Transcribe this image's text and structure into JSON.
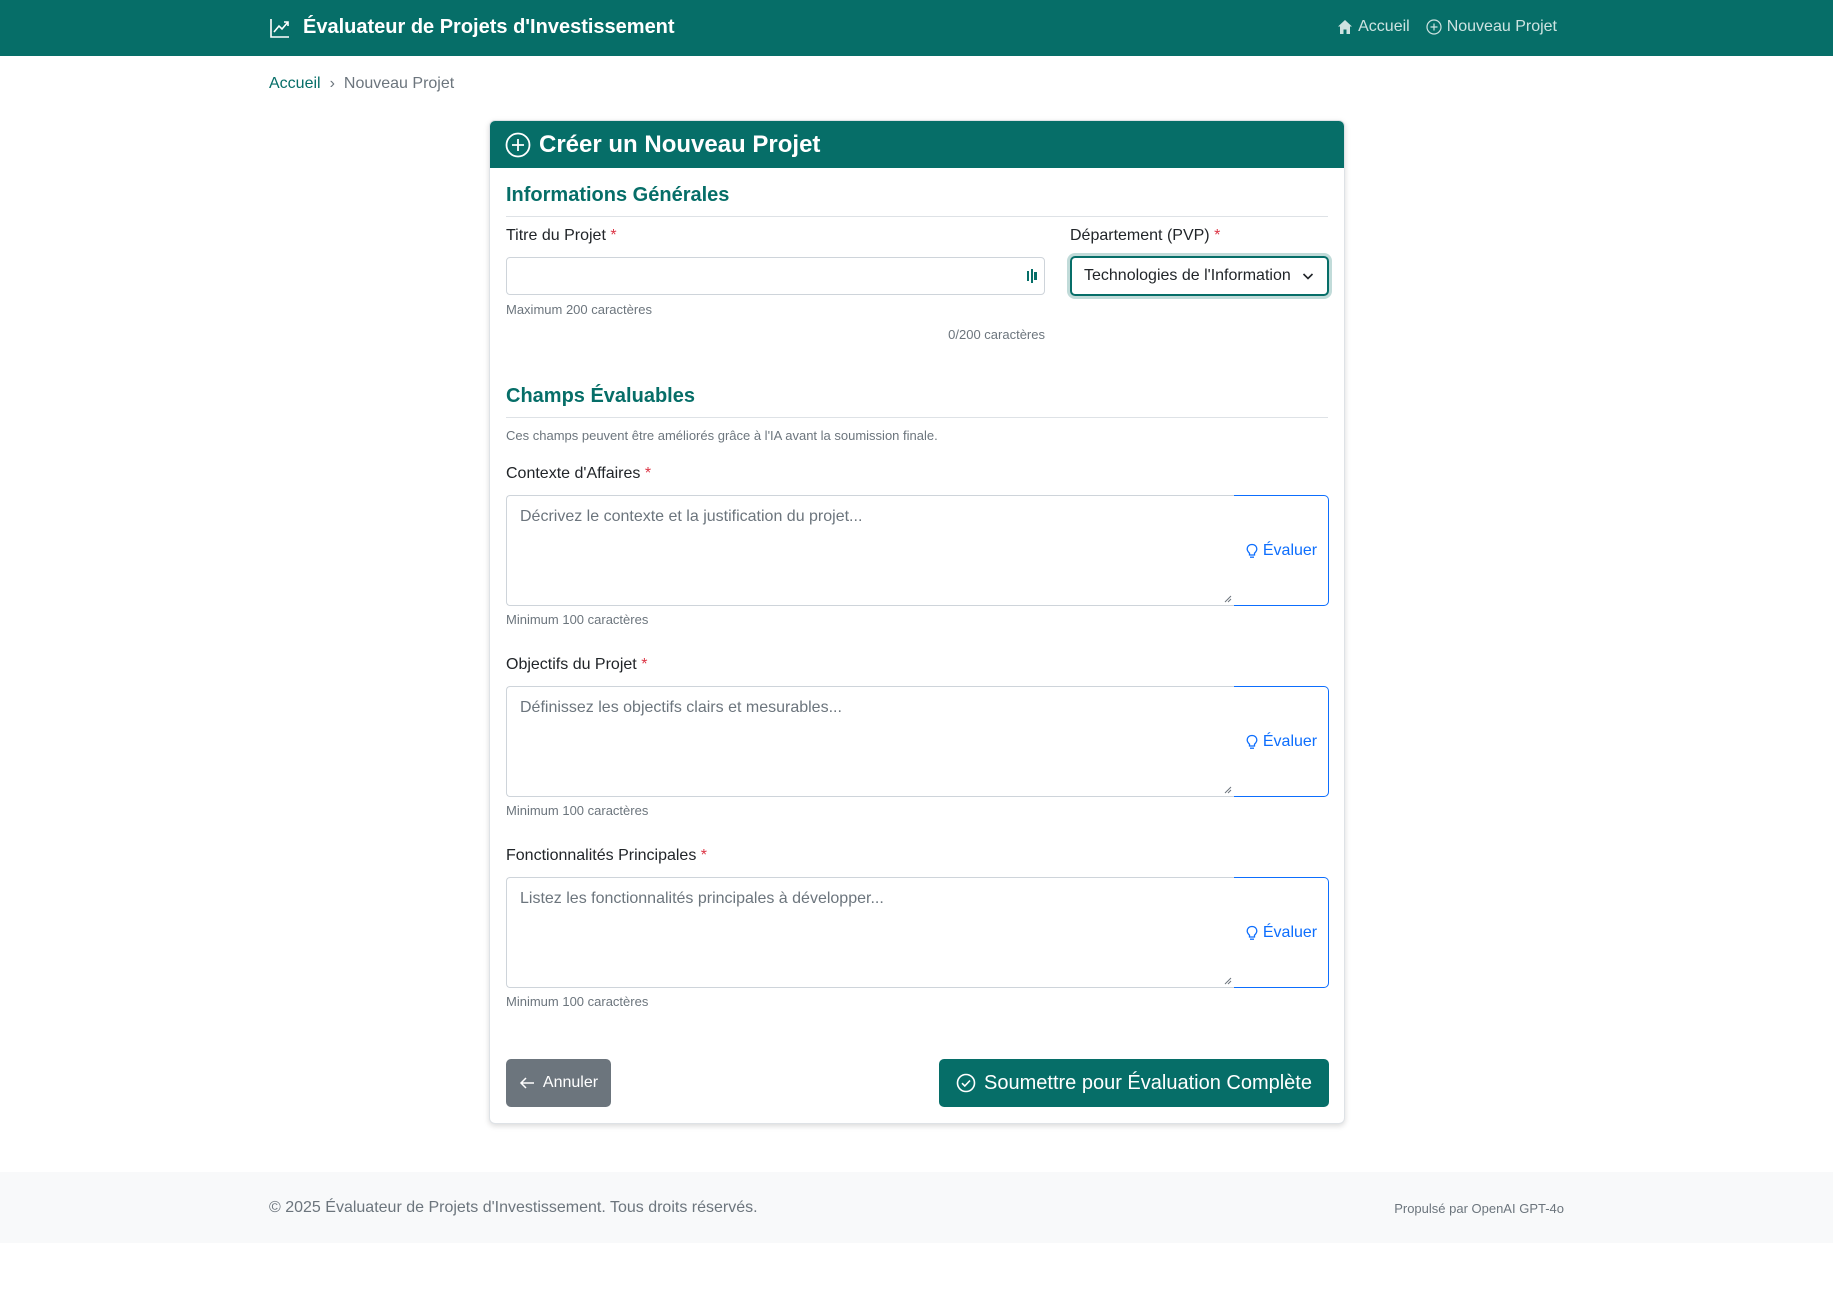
{
  "navbar": {
    "brand": "Évaluateur de Projets d'Investissement",
    "links": [
      {
        "label": "Accueil",
        "icon": "house-icon"
      },
      {
        "label": "Nouveau Projet",
        "icon": "plus-circle-icon"
      }
    ]
  },
  "breadcrumb": {
    "home": "Accueil",
    "separator": "›",
    "current": "Nouveau Projet"
  },
  "card": {
    "title": "Créer un Nouveau Projet"
  },
  "general": {
    "title": "Informations Générales",
    "project_title_label": "Titre du Projet",
    "required_mark": "*",
    "project_title_value": "",
    "project_title_help": "Maximum 200 caractères",
    "char_count": "0/200 caractères",
    "department_label": "Département (PVP)",
    "department_selected": "Technologies de l'Information"
  },
  "evaluable": {
    "title": "Champs Évaluables",
    "description": "Ces champs peuvent être améliorés grâce à l'IA avant la soumission finale.",
    "evaluate_label": "Évaluer",
    "fields": [
      {
        "label": "Contexte d'Affaires",
        "placeholder": "Décrivez le contexte et la justification du projet...",
        "help": "Minimum 100 caractères"
      },
      {
        "label": "Objectifs du Projet",
        "placeholder": "Définissez les objectifs clairs et mesurables...",
        "help": "Minimum 100 caractères"
      },
      {
        "label": "Fonctionnalités Principales",
        "placeholder": "Listez les fonctionnalités principales à développer...",
        "help": "Minimum 100 caractères"
      }
    ]
  },
  "actions": {
    "cancel_label": "Annuler",
    "submit_label": "Soumettre pour Évaluation Complète"
  },
  "footer": {
    "copyright": "© 2025 Évaluateur de Projets d'Investissement. Tous droits réservés.",
    "powered": "Propulsé par OpenAI GPT-4o"
  },
  "colors": {
    "primary": "#066e68",
    "link_blue": "#0d6efd",
    "danger": "#dc3545",
    "secondary": "#6c757d"
  }
}
